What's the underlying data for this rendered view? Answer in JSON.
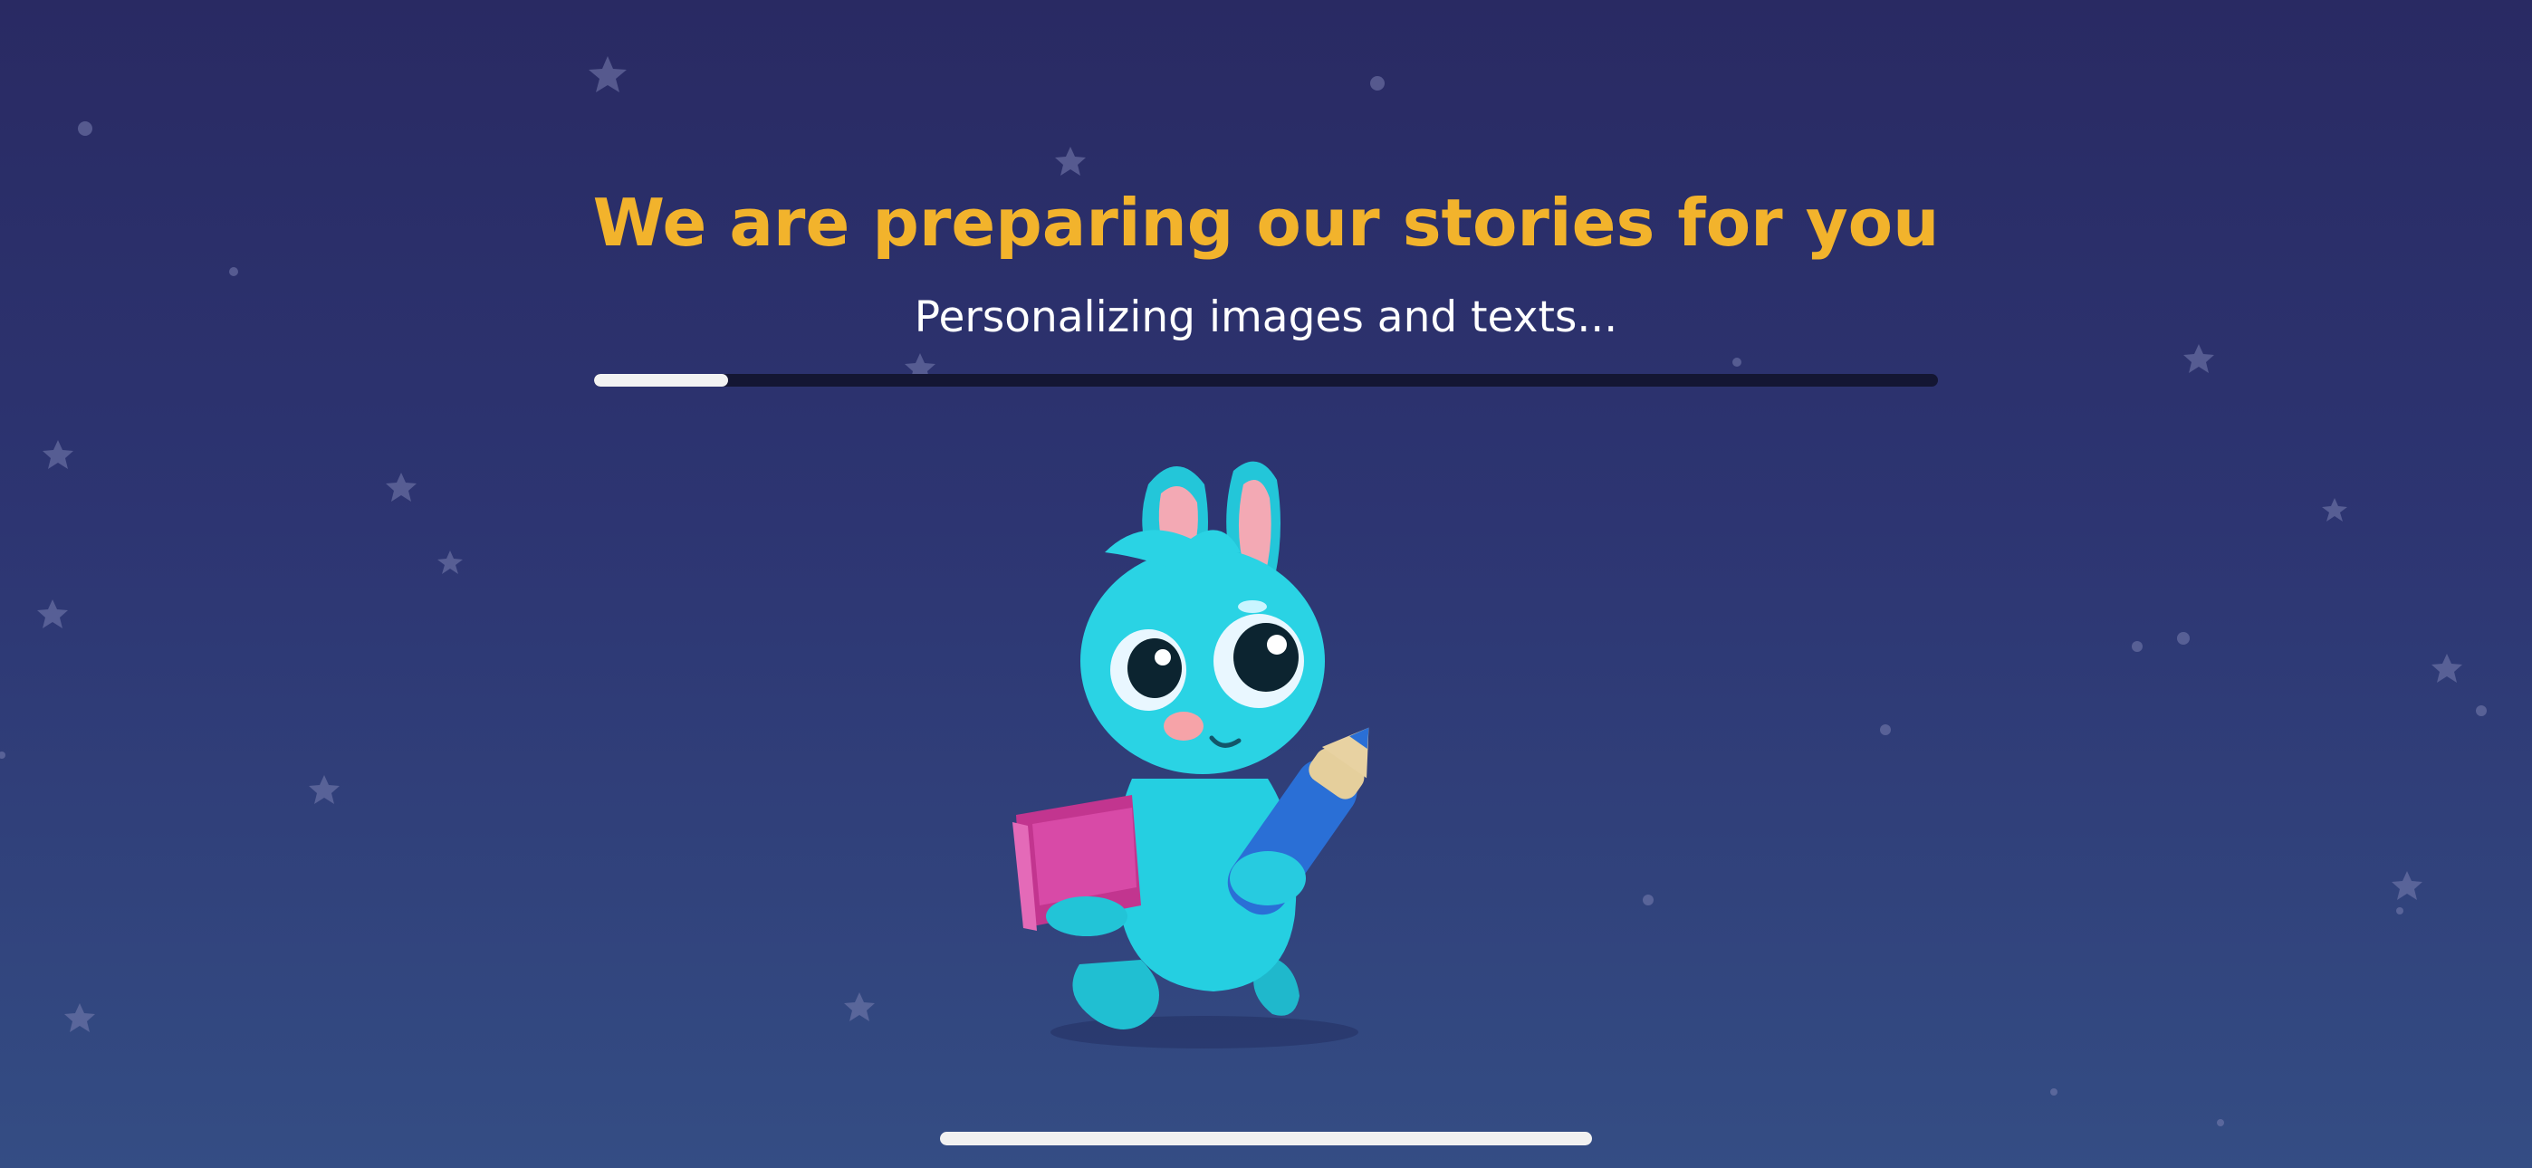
{
  "loading_screen": {
    "title": "We are preparing our stories for you",
    "status_text": "Personalizing images and texts...",
    "progress_fraction": 0.1
  },
  "mascot": {
    "description_icon": "bunny-mascot-with-book-and-pencil"
  },
  "colors": {
    "background_top": "#292a63",
    "background_bottom": "#344d84",
    "title": "#f2b32c",
    "progress_track": "#141633",
    "progress_fill": "#f2f2f2",
    "mascot_body": "#2ad3e4",
    "book": "#d23fa4",
    "pencil": "#2a6fd6"
  },
  "icons": {
    "background_decoration": "star-icon"
  }
}
